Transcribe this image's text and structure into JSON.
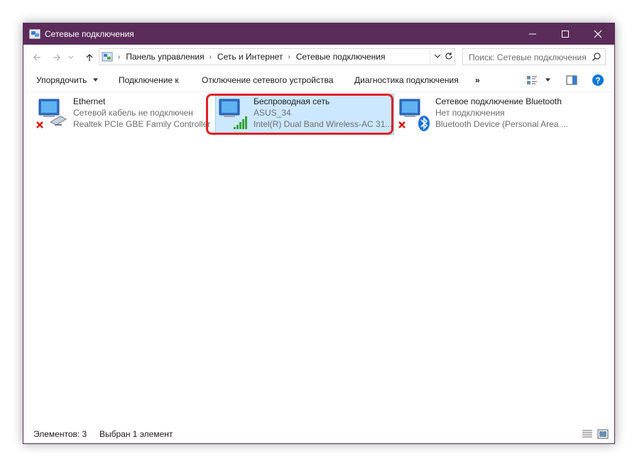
{
  "window": {
    "title": "Сетевые подключения",
    "titlebar_color": "#5b2c5a"
  },
  "address": {
    "breadcrumbs": [
      "Панель управления",
      "Сеть и Интернет",
      "Сетевые подключения"
    ]
  },
  "search": {
    "placeholder": "Поиск: Сетевые подключения"
  },
  "toolbar": {
    "organize": "Упорядочить",
    "connect": "Подключение к",
    "disable": "Отключение сетевого устройства",
    "diagnose": "Диагностика подключения",
    "more": "»"
  },
  "connections": [
    {
      "name": "Ethernet",
      "status": "Сетевой кабель не подключен",
      "device": "Realtek PCIe GBE Family Controller",
      "icon": "ethernet-disconnected-icon"
    },
    {
      "name": "Беспроводная сеть",
      "status": "ASUS_34",
      "device": "Intel(R) Dual Band Wireless-AC 31...",
      "icon": "wireless-connected-icon",
      "selected": true
    },
    {
      "name": "Сетевое подключение Bluetooth",
      "status": "Нет подключения",
      "device": "Bluetooth Device (Personal Area ...",
      "icon": "bluetooth-disconnected-icon"
    }
  ],
  "status": {
    "count": "Элементов: 3",
    "selected": "Выбран 1 элемент"
  },
  "colors": {
    "selection": "#cce8ff",
    "highlight": "#e02020",
    "accent": "#0078d7"
  }
}
